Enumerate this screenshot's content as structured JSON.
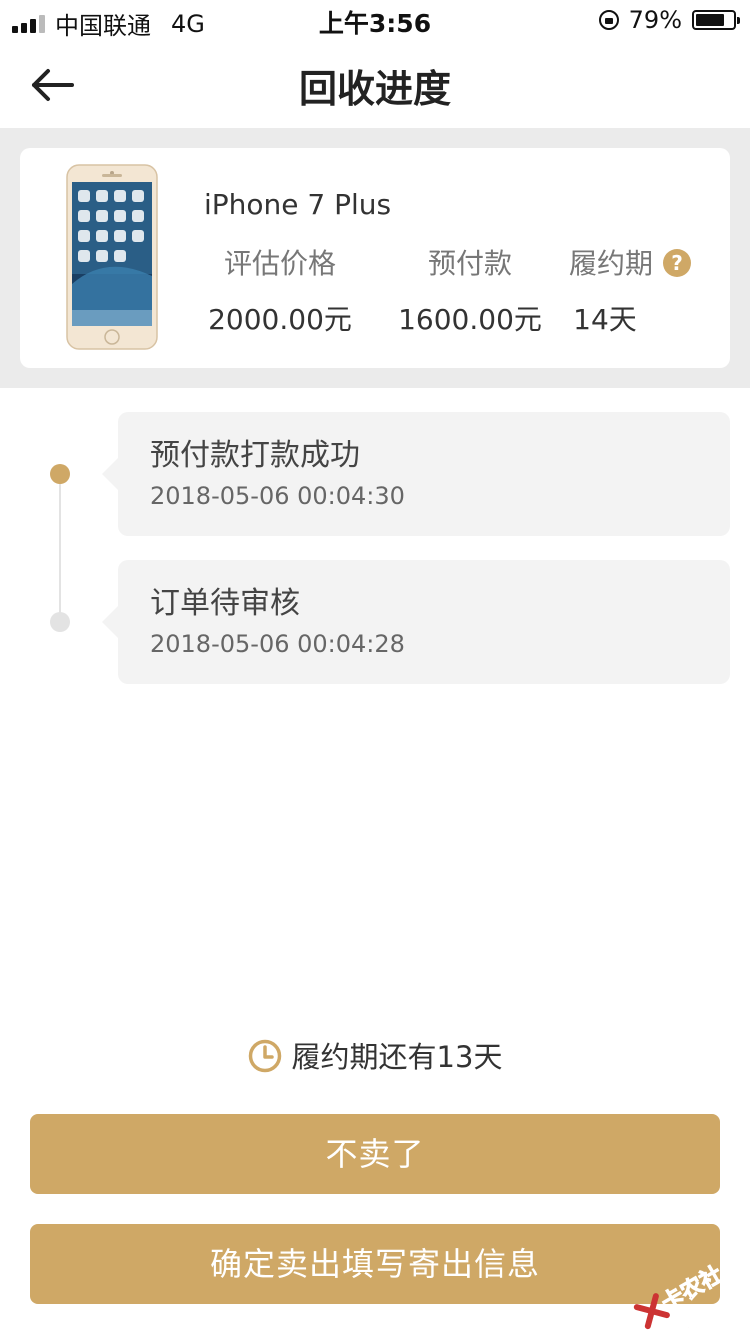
{
  "status_bar": {
    "carrier": "中国联通",
    "network": "4G",
    "time": "上午3:56",
    "battery": "79%",
    "battery_level": 0.79
  },
  "nav": {
    "title": "回收进度",
    "back_icon": "arrow-left-icon"
  },
  "product": {
    "name": "iPhone 7 Plus",
    "labels": {
      "estimated_price": "评估价格",
      "prepayment": "预付款",
      "term": "履约期"
    },
    "values": {
      "estimated_price": "2000.00元",
      "prepayment": "1600.00元",
      "term": "14天"
    },
    "help_symbol": "?"
  },
  "timeline": [
    {
      "title": "预付款打款成功",
      "time": "2018-05-06 00:04:30",
      "active": true
    },
    {
      "title": "订单待审核",
      "time": "2018-05-06 00:04:28",
      "active": false
    }
  ],
  "countdown": {
    "text": "履约期还有13天"
  },
  "buttons": {
    "cancel": "不卖了",
    "confirm": "确定卖出填写寄出信息"
  },
  "watermark": {
    "text": "卡农社区"
  },
  "colors": {
    "accent": "#cfa866",
    "gray_bg": "#ebebeb",
    "timeline_bg": "#f3f3f3"
  }
}
